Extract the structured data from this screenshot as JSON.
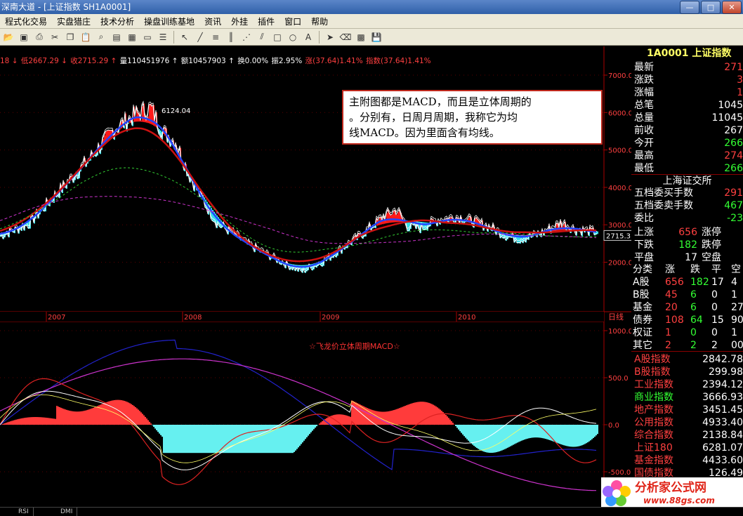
{
  "window": {
    "title": "深南大道 - [上证指数 SH1A0001]",
    "minimize": "—",
    "maximize": "□",
    "close": "✕"
  },
  "menu": [
    "程式化交易",
    "实盘猎庄",
    "技术分析",
    "操盘训练基地",
    "资讯",
    "外挂",
    "插件",
    "窗口",
    "帮助"
  ],
  "toolbar_icons": [
    "open-icon",
    "save-icon",
    "print-icon",
    "cut-icon",
    "copy-icon",
    "paste-icon",
    "find-icon",
    "chart-icon",
    "grid-icon",
    "window-icon",
    "list-icon",
    "pointer-icon",
    "line-icon",
    "trend-icon",
    "bars-icon",
    "fan-icon",
    "channel-icon",
    "rect-icon",
    "ellipse-icon",
    "text-icon",
    "arrow-icon",
    "eraser-icon",
    "palette-icon",
    "disk-icon"
  ],
  "info": {
    "items": [
      {
        "text": "18 ↓",
        "color": "#ff4040"
      },
      {
        "text": "低2667.29 ↓",
        "color": "#ff4040"
      },
      {
        "text": "收2715.29 ↑",
        "color": "#ff4040"
      },
      {
        "text": "量110451976 ↑",
        "color": "#ffffff"
      },
      {
        "text": "额10457903 ↑",
        "color": "#ffffff"
      },
      {
        "text": "换0.00%",
        "color": "#ffffff"
      },
      {
        "text": "振2.95%",
        "color": "#ffffff"
      },
      {
        "text": "涨(37.64)1.41%",
        "color": "#ff4040"
      },
      {
        "text": "指数(37.64)1.41%",
        "color": "#ff4040"
      }
    ]
  },
  "annotation": {
    "line1": "主附图都是MACD，而且是立体周期的",
    "line2": "。分别有，日周月周期，我称它为均",
    "line3": "线MACD。因为里面含有均线。"
  },
  "main_chart": {
    "peak_label": "6124.04",
    "y_ticks": [
      "7000.0",
      "6000.0",
      "5000.0",
      "4000.0",
      "3000.0",
      "2000.0"
    ],
    "current_price": "2715.3",
    "years": [
      "2007",
      "2008",
      "2009",
      "2010"
    ],
    "right_tag": "日线"
  },
  "sub_chart": {
    "title": "☆飞龙价立体周期MACD☆",
    "y_ticks": [
      "1000.0",
      "500.0",
      "0.0",
      "-500.0"
    ]
  },
  "panel": {
    "head": "1A0001 上证指数",
    "quote": [
      {
        "k": "最新",
        "v": "271",
        "c": "#ff4040"
      },
      {
        "k": "涨跌",
        "v": "3",
        "c": "#ff4040"
      },
      {
        "k": "涨幅",
        "v": "1",
        "c": "#ff4040"
      },
      {
        "k": "总笔",
        "v": "1045",
        "c": "#ffffff"
      },
      {
        "k": "总量",
        "v": "11045",
        "c": "#ffffff"
      },
      {
        "k": "前收",
        "v": "267",
        "c": "#ffffff"
      },
      {
        "k": "今开",
        "v": "266",
        "c": "#33ff33"
      },
      {
        "k": "最高",
        "v": "274",
        "c": "#ff4040"
      },
      {
        "k": "最低",
        "v": "266",
        "c": "#33ff33"
      }
    ],
    "exchange": "上海证交所",
    "orders": [
      {
        "k": "五档委买手数",
        "v": "291",
        "c": "#ff4040"
      },
      {
        "k": "五档委卖手数",
        "v": "467",
        "c": "#33ff33"
      },
      {
        "k": "委比",
        "v": "-23",
        "c": "#33ff33"
      }
    ],
    "breadth": [
      {
        "a": "上涨",
        "av": "656",
        "ac": "#ff4040",
        "b": "涨停"
      },
      {
        "a": "下跌",
        "av": "182",
        "ac": "#33ff33",
        "b": "跌停"
      },
      {
        "a": "平盘",
        "av": "17",
        "ac": "#ffffff",
        "b": "空盘"
      }
    ],
    "class_head": [
      "分类",
      "涨",
      "跌",
      "平",
      "空"
    ],
    "class_rows": [
      [
        "A股",
        "656",
        "182",
        "17",
        "4"
      ],
      [
        "B股",
        "45",
        "6",
        "0",
        "1"
      ],
      [
        "基金",
        "20",
        "6",
        "0",
        "27"
      ],
      [
        "债券",
        "108",
        "64",
        "15",
        "90"
      ],
      [
        "权证",
        "1",
        "0",
        "0",
        "1"
      ],
      [
        "其它",
        "2",
        "2",
        "2",
        "00"
      ]
    ],
    "indices": [
      {
        "k": "A股指数",
        "v": "2842.78",
        "c": "#ff4040"
      },
      {
        "k": "B股指数",
        "v": "299.98",
        "c": "#ff4040"
      },
      {
        "k": "工业指数",
        "v": "2394.12",
        "c": "#ff4040"
      },
      {
        "k": "商业指数",
        "v": "3666.93",
        "c": "#33ff33"
      },
      {
        "k": "地产指数",
        "v": "3451.45",
        "c": "#ff4040"
      },
      {
        "k": "公用指数",
        "v": "4933.40",
        "c": "#ff4040"
      },
      {
        "k": "综合指数",
        "v": "2138.84",
        "c": "#ff4040"
      },
      {
        "k": "上证180",
        "v": "6281.07",
        "c": "#ff4040"
      },
      {
        "k": "基金指数",
        "v": "4433.60",
        "c": "#ff4040"
      },
      {
        "k": "国债指数",
        "v": "126.49",
        "c": "#ff4040"
      }
    ]
  },
  "bottom_tabs": [
    "RSI",
    "DMI"
  ],
  "logo": {
    "name": "分析家公式网",
    "url": "www.88gs.com"
  },
  "colors": {
    "up": "#ff2020",
    "down": "#33e0e8",
    "grid": "#8b0000",
    "axis_text": "#ff4040"
  }
}
